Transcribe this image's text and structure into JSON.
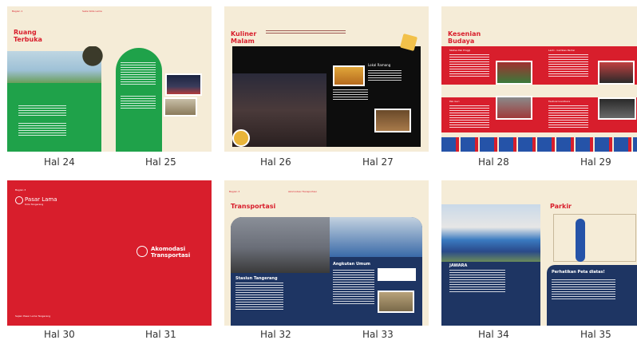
{
  "pages": {
    "p24_25": {
      "left": "Hal 24",
      "right": "Hal 25",
      "title": "Ruang\nTerbuka",
      "header_left": "Bagian 1",
      "header_right": "Seksi Kota Lama"
    },
    "p26_27": {
      "left": "Hal 26",
      "right": "Hal 27",
      "title": "Kuliner\nMalam",
      "caption": "Lokal Ramang"
    },
    "p28_29": {
      "left": "Hal 28",
      "right": "Hal 29",
      "title": "Kesenian\nBudaya",
      "cards": [
        "Sketsa Pak Pinggi",
        "Lanti - Gambas Pantai",
        "Pak Guri",
        "Festival Goodbara"
      ]
    },
    "p30_31": {
      "left": "Hal 30",
      "right": "Hal 31",
      "brand": "Pasar Lama",
      "brand_sub": "Kota Tangerang",
      "kicker": "Bagian 3",
      "section": "Akomodasi\nTransportasi",
      "footer": "Sajian Pasar Lama Tangerang"
    },
    "p32_33": {
      "left": "Hal 32",
      "right": "Hal 33",
      "title": "Transportasi",
      "header_left": "Bagian 3",
      "header_right": "Akomodasi Transportasi",
      "station": "Stasiun Tangerang",
      "angkot": "Angkutan Umum"
    },
    "p34_35": {
      "left": "Hal 34",
      "right": "Hal 35",
      "title": "Parkir",
      "bus": "JAWARA",
      "note": "Perhatikan Peta diatas!"
    }
  },
  "colors": {
    "red": "#d81e2c",
    "green": "#1fa24a",
    "navy": "#1e3563",
    "cream": "#f5ecd7"
  }
}
